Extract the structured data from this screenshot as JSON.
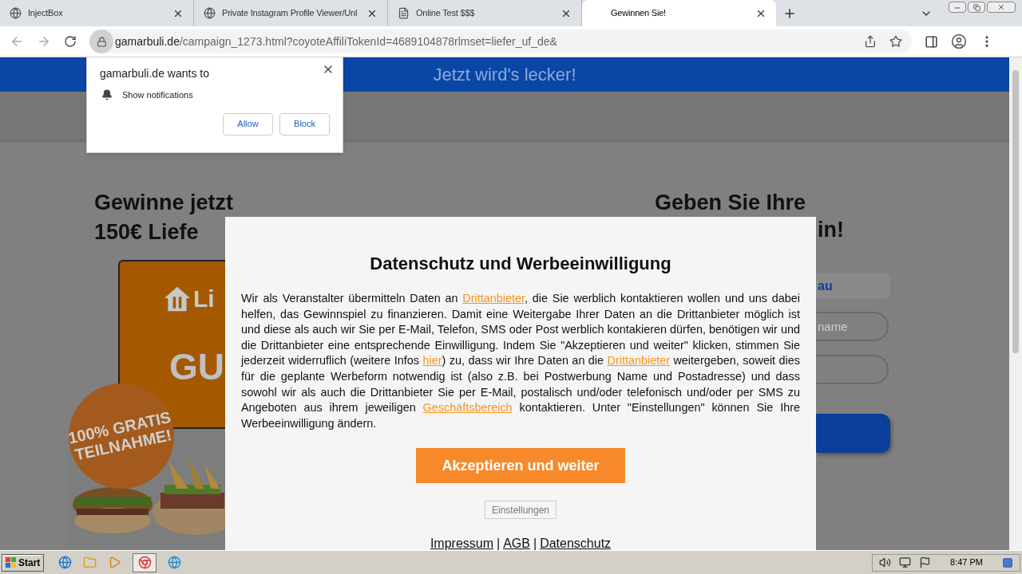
{
  "browser": {
    "tabs": [
      {
        "title": "InjectBox",
        "kind": "globe",
        "selected": false
      },
      {
        "title": "Private Instagram Profile Viewer/Unl",
        "kind": "globe",
        "selected": false
      },
      {
        "title": "Online Test $$$",
        "kind": "document",
        "selected": false
      },
      {
        "title": "Gewinnen Sie!",
        "kind": "blank",
        "selected": true
      }
    ],
    "address": {
      "host": "gamarbuli.de",
      "path": "/campaign_1273.html?coyoteAffiliTokenId=4689104878rlmset=liefer_uf_de&"
    }
  },
  "permission_prompt": {
    "title": "gamarbuli.de wants to",
    "permission": "Show notifications",
    "buttons": [
      "Allow",
      "Block"
    ]
  },
  "page": {
    "banner": "Jetzt wird's lecker!",
    "headline_lines": [
      "Gewinne jetzt",
      "150€ Liefe"
    ],
    "voucher": {
      "logo_text": "Li",
      "code_text": "GU"
    },
    "badge_lines": [
      "100% GRATIS",
      "TEILNAHME!"
    ],
    "form": {
      "heading_lines": [
        "Geben Sie Ihre",
        "in!"
      ],
      "salutation": "au",
      "name_placeholder": "name"
    }
  },
  "consent_dialog": {
    "title": "Datenschutz und Werbeeinwilligung",
    "text": [
      {
        "kind": "text",
        "text": "Wir als Veranstalter übermitteln Daten an "
      },
      {
        "kind": "link",
        "text": "Drittanbieter"
      },
      {
        "kind": "text",
        "text": ", die Sie werblich kontaktieren wollen und uns dabei helfen, das Gewinnspiel zu finanzieren. Damit eine Weitergabe Ihrer Daten an die Drittanbieter möglich ist und diese als auch wir Sie per E-Mail, Telefon, SMS oder Post werblich kontakieren dürfen, benötigen wir und die Drittanbieter eine entsprechende Einwilligung. Indem Sie \"Akzeptieren und weiter\" klicken, stimmen Sie jederzeit widerruflich (weitere Infos "
      },
      {
        "kind": "link",
        "text": "hier"
      },
      {
        "kind": "text",
        "text": ") zu, dass wir Ihre Daten an die "
      },
      {
        "kind": "link",
        "text": "Drittanbieter"
      },
      {
        "kind": "text",
        "text": " weitergeben, soweit dies für die geplante Werbeform notwendig ist (also z.B. bei Postwerbung Name und Postadresse) und dass sowohl wir als auch die Drittanbieter Sie per E-Mail, postalisch und/oder telefonisch und/oder per SMS zu Angeboten aus ihrem jeweiligen "
      },
      {
        "kind": "link",
        "text": "Geschäftsbereich"
      },
      {
        "kind": "text",
        "text": " kontaktieren. Unter \"Einstellungen\" können Sie Ihre Werbeeinwilligung ändern."
      }
    ],
    "accept_button": "Akzeptieren und weiter",
    "settings_button": "Einstellungen",
    "footer": [
      {
        "kind": "link",
        "text": "Impressum"
      },
      {
        "kind": "separator",
        "text": "|"
      },
      {
        "kind": "link",
        "text": "AGB"
      },
      {
        "kind": "separator",
        "text": "|"
      },
      {
        "kind": "link",
        "text": "Datenschutz"
      }
    ]
  },
  "taskbar": {
    "start": "Start",
    "clock": "8:47 PM"
  }
}
